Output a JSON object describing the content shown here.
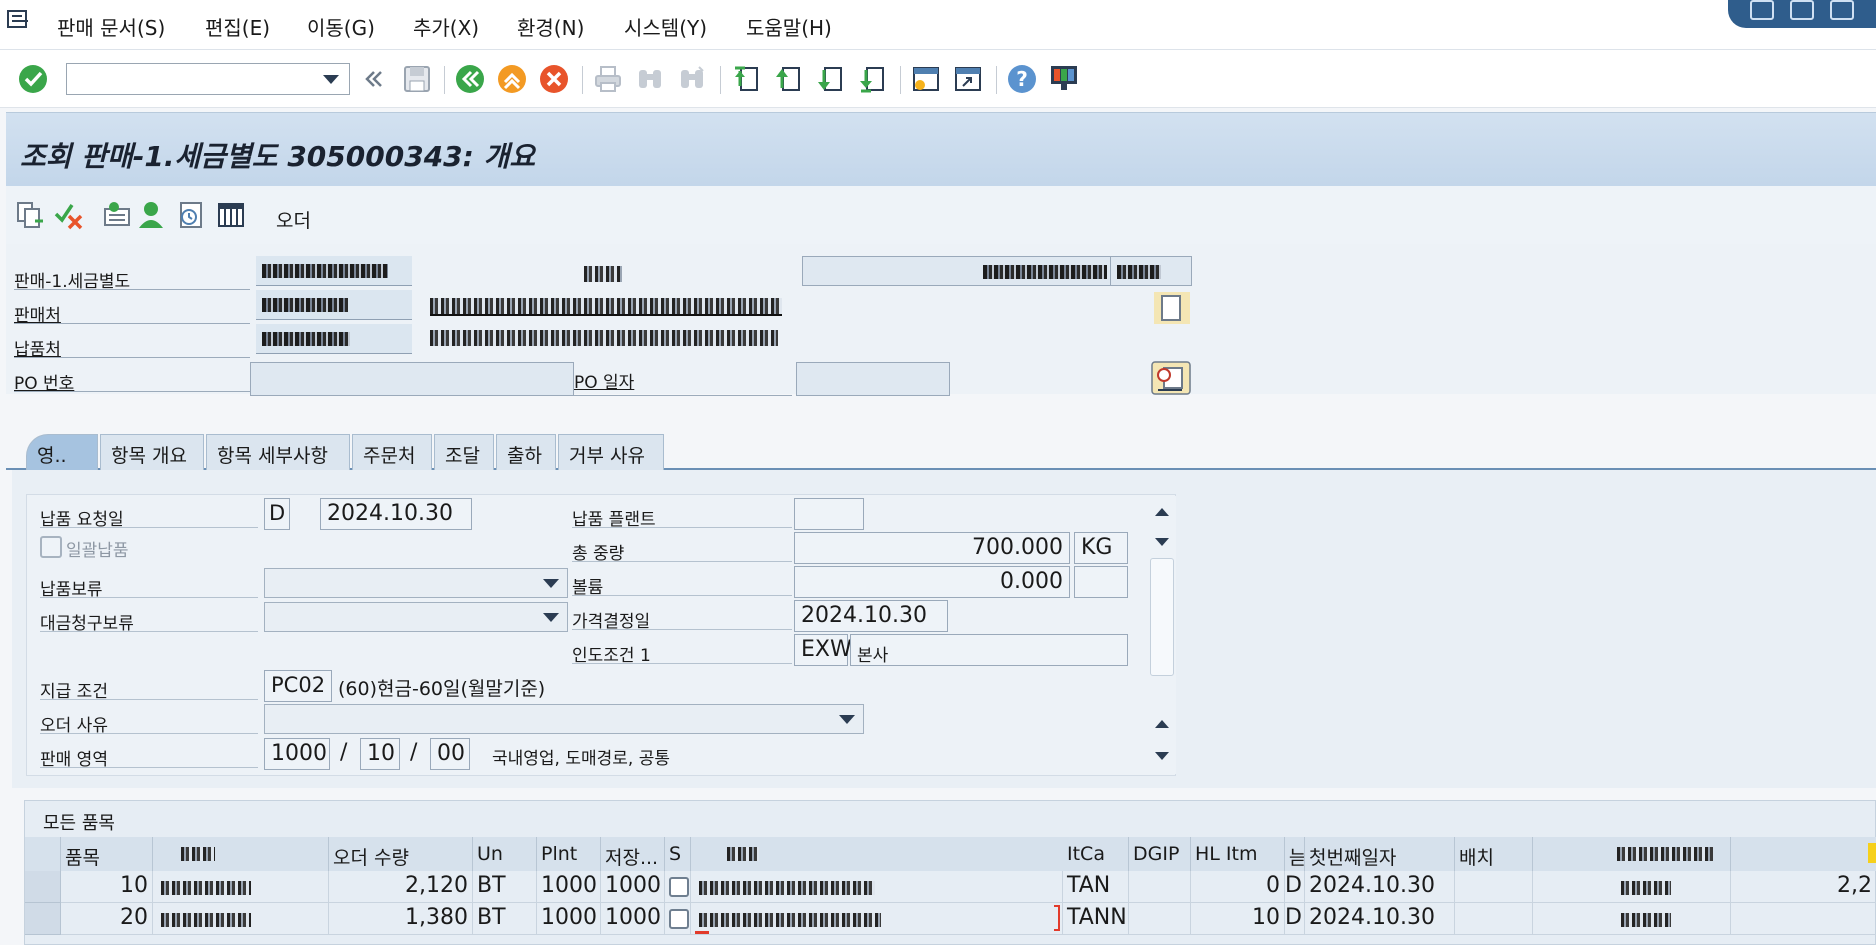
{
  "menubar": {
    "items": [
      "판매 문서(S)",
      "편집(E)",
      "이동(G)",
      "추가(X)",
      "환경(N)",
      "시스템(Y)",
      "도움말(H)"
    ]
  },
  "toolbar": {
    "command_field_value": "",
    "icons": [
      "enter-icon",
      "back-icon",
      "save-icon",
      "back-green-icon",
      "exit-icon",
      "cancel-icon",
      "print-icon",
      "find-icon",
      "find-next-icon",
      "first-page-icon",
      "previous-page-icon",
      "next-page-icon",
      "last-page-icon",
      "new-session-icon",
      "shortcut-icon",
      "help-icon",
      "layout-menu-icon"
    ]
  },
  "title": "조회 판매-1.세금별도 305000343: 개요",
  "app_toolbar": {
    "order_label": "오더"
  },
  "header": {
    "labels": {
      "doc_type": "판매-1.세금별도",
      "sold_to": "판매처",
      "ship_to": "납품처",
      "po_number": "PO 번호",
      "po_date": "PO 일자"
    },
    "po_number_value": "",
    "po_date_value": ""
  },
  "tabs": [
    "영..",
    "항목 개요",
    "항목 세부사항",
    "주문처",
    "조달",
    "출하",
    "거부 사유"
  ],
  "sales_tab": {
    "req_delivery_date_label": "납품 요청일",
    "req_delivery_date_type": "D",
    "req_delivery_date": "2024.10.30",
    "complete_delivery_label": "일괄납품",
    "delivery_block_label": "납품보류",
    "billing_block_label": "대금청구보류",
    "payment_terms_label": "지급 조건",
    "payment_terms_code": "PC02",
    "payment_terms_text": "(60)현금-60일(월말기준)",
    "order_reason_label": "오더 사유",
    "sales_area_label": "판매 영역",
    "sales_org": "1000",
    "dist_channel": "10",
    "division": "00",
    "sales_area_text": "국내영업, 도매경로, 공통",
    "delivery_plant_label": "납품 플랜트",
    "delivery_plant_value": "",
    "total_weight_label": "총 중량",
    "total_weight": "700.000",
    "weight_unit": "KG",
    "volume_label": "볼륨",
    "volume": "0.000",
    "volume_unit": "",
    "pricing_date_label": "가격결정일",
    "pricing_date": "2024.10.30",
    "incoterms_label": "인도조건 1",
    "incoterms_code": "EXW",
    "incoterms_text": "본사",
    "slash": "/"
  },
  "items_table": {
    "title": "모든 품목",
    "headers": [
      "품목",
      "오더 수량",
      "Un",
      "Plnt",
      "저장...",
      "S",
      "ItCa",
      "DGIP",
      "HL Itm",
      "늗",
      "첫번째일자",
      "배치"
    ],
    "rows": [
      {
        "item": "10",
        "qty": "2,120",
        "unit": "BT",
        "plant": "1000",
        "sloc": "1000",
        "itca": "TAN",
        "dgip": "",
        "hl_item": "0",
        "flag": "D",
        "first_date": "2024.10.30",
        "batch": "",
        "extra": "2,2"
      },
      {
        "item": "20",
        "qty": "1,380",
        "unit": "BT",
        "plant": "1000",
        "sloc": "1000",
        "itca": "TANN",
        "dgip": "",
        "hl_item": "10",
        "flag": "D",
        "first_date": "2024.10.30",
        "batch": "",
        "extra": ""
      }
    ]
  },
  "colors": {
    "title_bg": "#c8dbed",
    "accent": "#4f7fb0",
    "enter_green": "#3aa64a"
  }
}
